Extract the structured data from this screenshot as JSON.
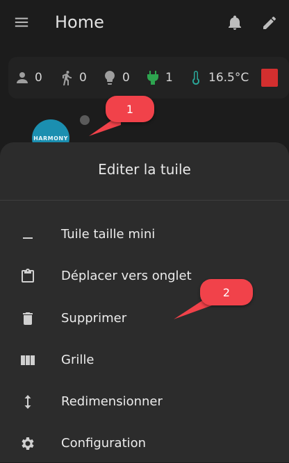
{
  "header": {
    "title": "Home",
    "menu_icon": "menu-icon",
    "bell_icon": "bell-icon",
    "edit_icon": "pencil-icon"
  },
  "status": {
    "items": [
      {
        "icon": "person-icon",
        "value": "0"
      },
      {
        "icon": "walking-person-icon",
        "value": "0"
      },
      {
        "icon": "lightbulb-icon",
        "value": "0"
      },
      {
        "icon": "ev-plug-icon",
        "value": "1"
      },
      {
        "icon": "thermometer-icon",
        "value": "16.5°C"
      }
    ],
    "colors": {
      "plug": "#2ea44f",
      "thermo": "#2aa89a",
      "alert": "#d32f2f"
    }
  },
  "tile": {
    "badge_label": "HARMONY"
  },
  "callouts": [
    {
      "number": "1"
    },
    {
      "number": "2"
    }
  ],
  "sheet": {
    "title": "Editer la tuile",
    "items": [
      {
        "label": "Tuile taille mini",
        "icon": "minus-icon"
      },
      {
        "label": "Déplacer vers onglet",
        "icon": "clipboard-icon"
      },
      {
        "label": "Supprimer",
        "icon": "trash-icon"
      },
      {
        "label": "Grille",
        "icon": "columns-icon"
      },
      {
        "label": "Redimensionner",
        "icon": "resize-vertical-icon"
      },
      {
        "label": "Configuration",
        "icon": "gear-icon"
      }
    ]
  },
  "accent": "#f1424a"
}
